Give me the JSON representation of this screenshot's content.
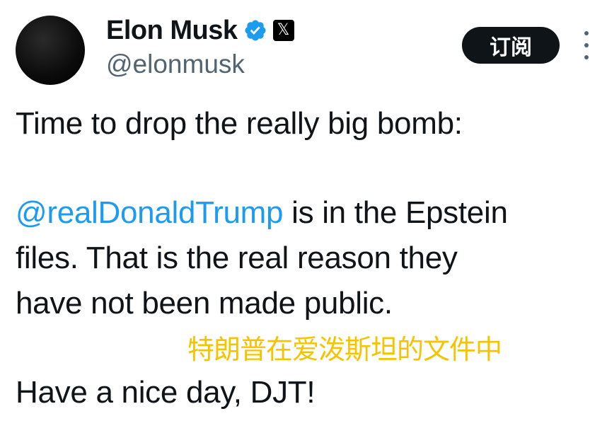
{
  "author": {
    "display_name": "Elon Musk",
    "handle": "@elonmusk",
    "verified_icon": "verified-badge-icon",
    "affiliation_icon": "x-logo-icon",
    "affiliation_glyph": "𝕏"
  },
  "actions": {
    "subscribe_label": "订阅",
    "more_icon": "more-icon"
  },
  "tweet": {
    "line1": "Time to drop the really big bomb:",
    "mention": "@realDonaldTrump",
    "line2_rest": " is in the Epstein",
    "line3": "files. That is the real reason they",
    "line4": "have not been made public.",
    "line6": "Have a nice day, DJT!"
  },
  "overlay_caption": "特朗普在爱泼斯坦的文件中",
  "colors": {
    "mention": "#1d9bf0",
    "caption": "#f5c400",
    "verified": "#1d9bf0",
    "button_bg": "#0f1419"
  }
}
